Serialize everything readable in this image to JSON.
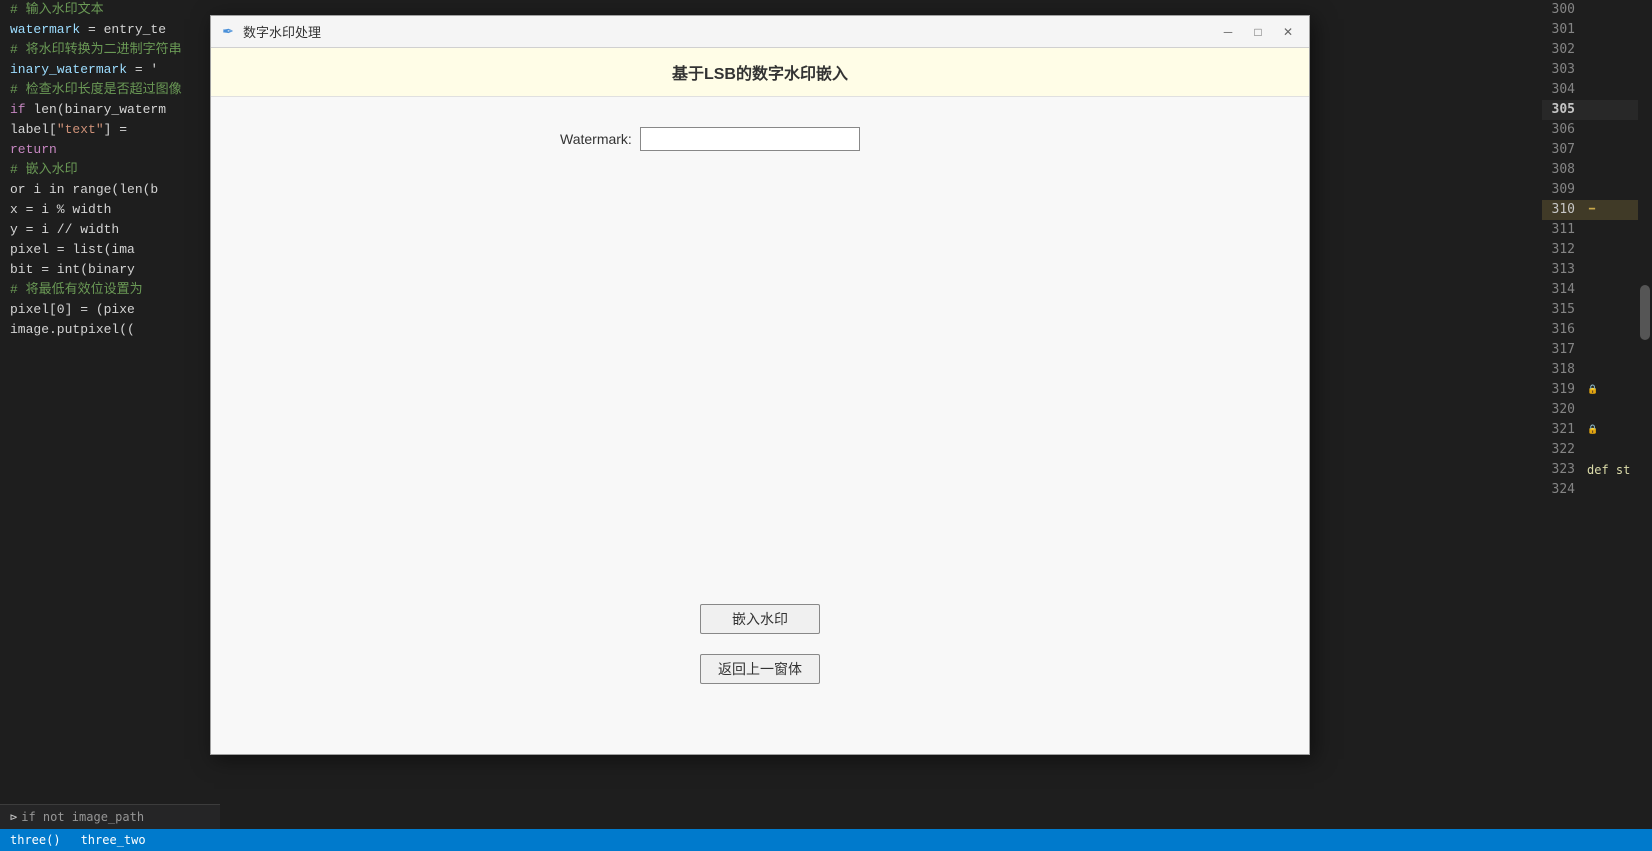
{
  "editor": {
    "left_code_lines": [
      {
        "text": "输入水印文本",
        "type": "comment"
      },
      {
        "text": "watermark = entry_te",
        "type": "code"
      },
      {
        "text": "",
        "type": "blank"
      },
      {
        "text": "将水印转换为二进制字符串",
        "type": "comment"
      },
      {
        "text": "inary_watermark = '",
        "type": "code"
      },
      {
        "text": "",
        "type": "blank"
      },
      {
        "text": "检查水印长度是否超过图像",
        "type": "comment"
      },
      {
        "text": "if len(binary_waterm",
        "type": "code"
      },
      {
        "text": "    label[\"text\"] =",
        "type": "code"
      },
      {
        "text": "    return",
        "type": "code-keyword"
      },
      {
        "text": "",
        "type": "blank"
      },
      {
        "text": "嵌入水印",
        "type": "comment"
      },
      {
        "text": "or i in range(len(b",
        "type": "code"
      },
      {
        "text": "    x = i % width",
        "type": "code"
      },
      {
        "text": "    y = i // width",
        "type": "code"
      },
      {
        "text": "",
        "type": "blank"
      },
      {
        "text": "    pixel = list(ima",
        "type": "code"
      },
      {
        "text": "    bit = int(binary",
        "type": "code"
      },
      {
        "text": "",
        "type": "blank"
      },
      {
        "text": "# 将最低有效位设置为",
        "type": "comment"
      },
      {
        "text": "    pixel[0] = (pixe",
        "type": "code"
      },
      {
        "text": "",
        "type": "blank"
      },
      {
        "text": "    image.putpixel((",
        "type": "code"
      }
    ],
    "right_line_numbers": [
      300,
      301,
      302,
      303,
      304,
      305,
      306,
      307,
      308,
      309,
      310,
      311,
      312,
      313,
      314,
      315,
      316,
      317,
      318,
      319,
      320,
      321,
      322,
      323,
      324
    ],
    "active_line": 305,
    "highlighted_line": 310
  },
  "dialog": {
    "title_icon": "✒",
    "title": "数字水印处理",
    "minimize_label": "─",
    "maximize_label": "□",
    "close_label": "✕",
    "banner_text": "基于LSB的数字水印嵌入",
    "watermark_label": "Watermark:",
    "watermark_placeholder": "",
    "watermark_value": "",
    "embed_button_label": "嵌入水印",
    "back_button_label": "返回上一窗体"
  },
  "status_bar": {
    "items": [
      "three()",
      "three_two"
    ]
  },
  "bottom_panel": {
    "left_text": "if not image_path"
  }
}
